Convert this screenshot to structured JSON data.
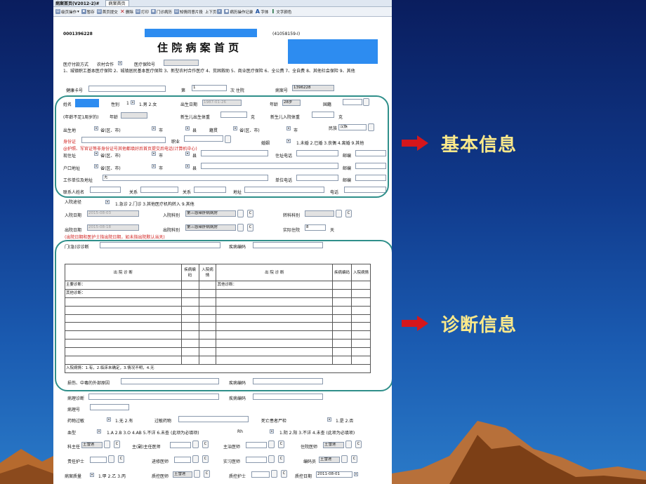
{
  "window": {
    "title": "病案首页(V2012-2)#",
    "tab": "病案首页"
  },
  "toolbar": [
    {
      "label": "级页操作",
      "icon": "page-icon",
      "mark": "▤"
    },
    {
      "label": "暂存",
      "icon": "save-icon",
      "mark": "▪"
    },
    {
      "label": "首页提交",
      "icon": "submit-icon",
      "mark": "▤"
    },
    {
      "label": "删除",
      "icon": "delete-icon",
      "mark": "✕"
    },
    {
      "label": "打印",
      "icon": "print-icon",
      "mark": "▤"
    },
    {
      "label": "门诊病历",
      "icon": "outpatient-icon",
      "mark": "◉"
    },
    {
      "label": "知情同意片段",
      "icon": "consent-icon",
      "mark": "▤"
    },
    {
      "label": "上下页",
      "icon": "pager-icon",
      "mark": "▸"
    },
    {
      "label": "病历操作记录",
      "icon": "record-icon",
      "mark": "●"
    },
    {
      "label": "字体",
      "icon": "font-icon",
      "mark": "A"
    },
    {
      "label": "文字颜色",
      "icon": "text-color-icon",
      "mark": "I"
    }
  ],
  "header": {
    "record_no": "0001396228",
    "code": "(41058159-I)",
    "title": "住 院 病 案 首 页"
  },
  "payment": {
    "label": "医疗付款方式",
    "value": "农村合作",
    "insurance_label": "医疗保险号",
    "options_text": "1、城镇职工基本医疗保险 2、城镇居民基本医疗保险 3、新型农村合作医疗 4、贫困救助 5、商业医疗保险 6、全公费 7、全自费 8、其他社会保险 9、其他"
  },
  "health": {
    "card_label": "健康卡号",
    "times_label": "第",
    "times_value": "1",
    "times_suffix": "次 住院",
    "case_no_label": "病案号",
    "case_no": "1396228"
  },
  "basic": {
    "name_label": "姓名",
    "sex_label": "性别",
    "sex_value": "1",
    "sex_options": "1.男 2.女",
    "birth_label": "出生日期",
    "birth_value": "1987-01-26",
    "age_label": "年龄",
    "age_value": "28岁",
    "nation_label": "国籍",
    "infant_label": "(年龄不足1周岁的)",
    "infant_age_label": "年龄",
    "newborn_weight_label": "新生儿出生体重",
    "gram": "克",
    "newborn_in_label": "新生儿入院体重",
    "birthplace_label": "出生地",
    "province": "省(区、市)",
    "city": "市",
    "county": "县",
    "origin_label": "籍贯",
    "ethnic_label": "民族",
    "ethnic_value": "汉族",
    "id_label": "身份证",
    "job_label": "职业",
    "marriage_label": "婚姻",
    "marriage_options": "1.未婚 2.已婚 3.丧偶 4.离婚 9.其他",
    "id_note": "@护照、军官证等非身份证号其他都填好后首页提交后电话(计算机中心)",
    "address_label": "现住址",
    "home_phone_label": "住址电话",
    "zip_label": "邮编",
    "hukou_label": "户口地址",
    "work_label": "工作单位及地址",
    "work_value": "无",
    "work_phone_label": "单位电话",
    "contact_label": "联系人姓名",
    "relation_label": "关系",
    "relation2_label": "关系",
    "addr_label": "地址",
    "phone_label": "电话"
  },
  "admission": {
    "route_label": "入院途径",
    "route_options": "1.急诊 2.门诊 3.其他医疗机构转入 9.其他",
    "in_date_label": "入院日期",
    "in_date": "2015-08-03",
    "in_dept_label": "入院科别",
    "in_dept": "第三感染肝病病房",
    "transfer_label": "转科科别",
    "out_date_label": "出院日期",
    "out_date": "2015-08-18",
    "out_dept_label": "出院科别",
    "out_dept": "第三感染肝病病房",
    "days_label": "实际住院",
    "days_value": "8",
    "days_unit": "天",
    "out_note": "(出院日期和医护士指出院日期，如未指出院默认当天)",
    "opd_label": "门(急)诊诊断",
    "disease_code_label": "疾病编码"
  },
  "diagnosis": {
    "col_diag": "出 院 诊 断",
    "col_code": "疾病编码",
    "col_cond": "入院病情",
    "main_label": "主要诊断：",
    "other_label": "其他诊断：",
    "other_label2": "其他诊断：",
    "cond_legend": "入院病情：1.有，2.临床未确定，3.情况不明，4.无"
  },
  "bottom": {
    "injury_label": "损伤、中毒的外部原因",
    "code_label": "疾病编码",
    "pathology_label": "病理诊断",
    "code2_label": "疾病编码",
    "pathology_no": "病理号",
    "allergy_label": "药物过敏",
    "allergy_options": "1.无 2.有",
    "allergy_drug": "过敏药物",
    "autopsy_label": "死亡患者尸检",
    "autopsy_options": "1.是 2.否",
    "blood_label": "血型",
    "blood_options": "1.A 2.B 3.O 4.AB 5.不详 6.未查 (此项为必填项)",
    "rh_label": "Rh",
    "rh_options": "1.阴 2.阳 3.不详 4.未查 (此项为必填项)",
    "dept_head": "科主任",
    "dept_head_val": "王雪莲",
    "chief_label": "主(副)主任医师",
    "attending_label": "主治医师",
    "resident_label": "住院医师",
    "resident_val": "王雪莲",
    "nurse_label": "责任护士",
    "fellow_label": "进修医师",
    "intern_label": "实习医师",
    "coder_label": "编码员",
    "coder_val": "王雪莲",
    "quality_label": "病案质量",
    "quality_options": "1.甲 2.乙 3.丙",
    "qc_doc_label": "质控医师",
    "qc_doc_val": "王雪莲",
    "qc_nurse_label": "质控护士",
    "qc_date_label": "质控日期",
    "qc_date": "2011-08-01"
  },
  "annotations": {
    "basic": "基本信息",
    "diagnosis": "诊断信息"
  },
  "colors": {
    "annotation_text": "#fbe98a",
    "arrow": "#d4161c",
    "oval": "#2f8f8a",
    "redaction": "#2d8cf0"
  }
}
